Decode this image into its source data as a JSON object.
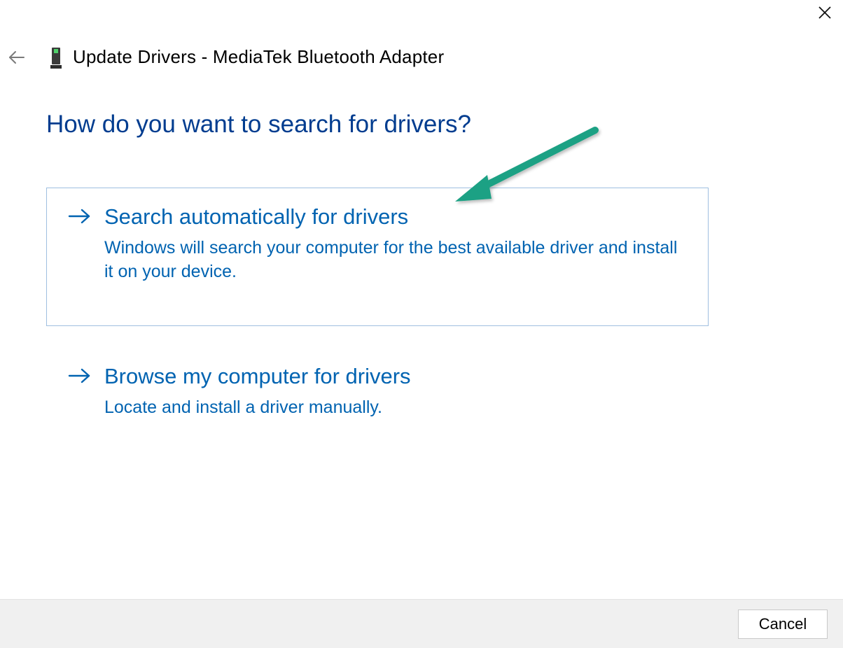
{
  "colors": {
    "heading": "#003c8f",
    "link": "#0063b1",
    "annotation": "#1fa184",
    "footer_bg": "#f0f0f0"
  },
  "title": "Update Drivers - MediaTek Bluetooth Adapter",
  "heading": "How do you want to search for drivers?",
  "options": [
    {
      "title": "Search automatically for drivers",
      "desc": "Windows will search your computer for the best available driver and install it on your device."
    },
    {
      "title": "Browse my computer for drivers",
      "desc": "Locate and install a driver manually."
    }
  ],
  "footer": {
    "cancel_label": "Cancel"
  }
}
